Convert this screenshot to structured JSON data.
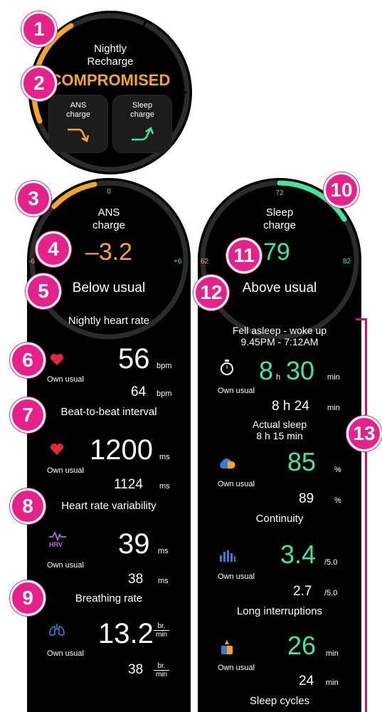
{
  "badges": [
    "1",
    "2",
    "3",
    "4",
    "5",
    "6",
    "7",
    "8",
    "9",
    "10",
    "11",
    "12",
    "13"
  ],
  "recharge": {
    "title_line1": "Nightly",
    "title_line2": "Recharge",
    "status": "COMPROMISED",
    "ans_card_line1": "ANS",
    "ans_card_line2": "charge",
    "sleep_card_line1": "Sleep",
    "sleep_card_line2": "charge"
  },
  "ans": {
    "title_line1": "ANS",
    "title_line2": "charge",
    "scale_zero": "0",
    "scale_min": "-6",
    "scale_max": "+6",
    "value": "–3.2",
    "status": "Below usual",
    "sections": [
      {
        "title": "Nightly heart rate",
        "value": "56",
        "unit": "bpm",
        "own_label": "Own usual",
        "usual_value": "64",
        "usual_unit": "bpm"
      },
      {
        "title": "Beat-to-beat interval",
        "value": "1200",
        "unit": "ms",
        "own_label": "Own usual",
        "usual_value": "1124",
        "usual_unit": "ms"
      },
      {
        "title": "Heart rate variability",
        "value": "39",
        "unit": "ms",
        "own_label": "Own usual",
        "usual_value": "38",
        "usual_unit": "ms",
        "icon_text": "HRV"
      },
      {
        "title": "Breathing rate",
        "value": "13.2",
        "unit_top": "br.",
        "unit_bottom": "min",
        "own_label": "Own usual",
        "usual_value": "38",
        "usual_unit_top": "br.",
        "usual_unit_bottom": "min"
      }
    ]
  },
  "sleep": {
    "title_line1": "Sleep",
    "title_line2": "charge",
    "scale_top": "72",
    "scale_min": "62",
    "scale_max": "82",
    "value": "79",
    "status": "Above usual",
    "fell_asleep_label": "Fell asleep - woke up",
    "fell_asleep_times": "9.45PM - 7:12AM",
    "duration_h": "8",
    "duration_h_unit": "h",
    "duration_min": "30",
    "duration_min_unit": "min",
    "own_label": "Own usual",
    "usual_duration": "8 h 24",
    "usual_duration_unit": "min",
    "actual_sleep_label": "Actual sleep",
    "actual_sleep_value": "8 h 15 min",
    "metrics": [
      {
        "value": "85",
        "unit": "%",
        "own_label": "Own usual",
        "usual_value": "89",
        "usual_unit": "%",
        "title": "Continuity"
      },
      {
        "value": "3.4",
        "unit": "/5.0",
        "own_label": "Own usual",
        "usual_value": "2.7",
        "usual_unit": "/5.0",
        "title": "Long interruptions"
      },
      {
        "value": "26",
        "unit": "min",
        "own_label": "Own usual",
        "usual_value": "24",
        "usual_unit": "min",
        "title": "Sleep cycles"
      }
    ]
  },
  "colors": {
    "accent_orange": "#f5a623",
    "accent_green": "#3ee6a4",
    "badge_pink": "#e8208a",
    "heart_red": "#e8243c",
    "icon_blue": "#3a7bd5"
  }
}
